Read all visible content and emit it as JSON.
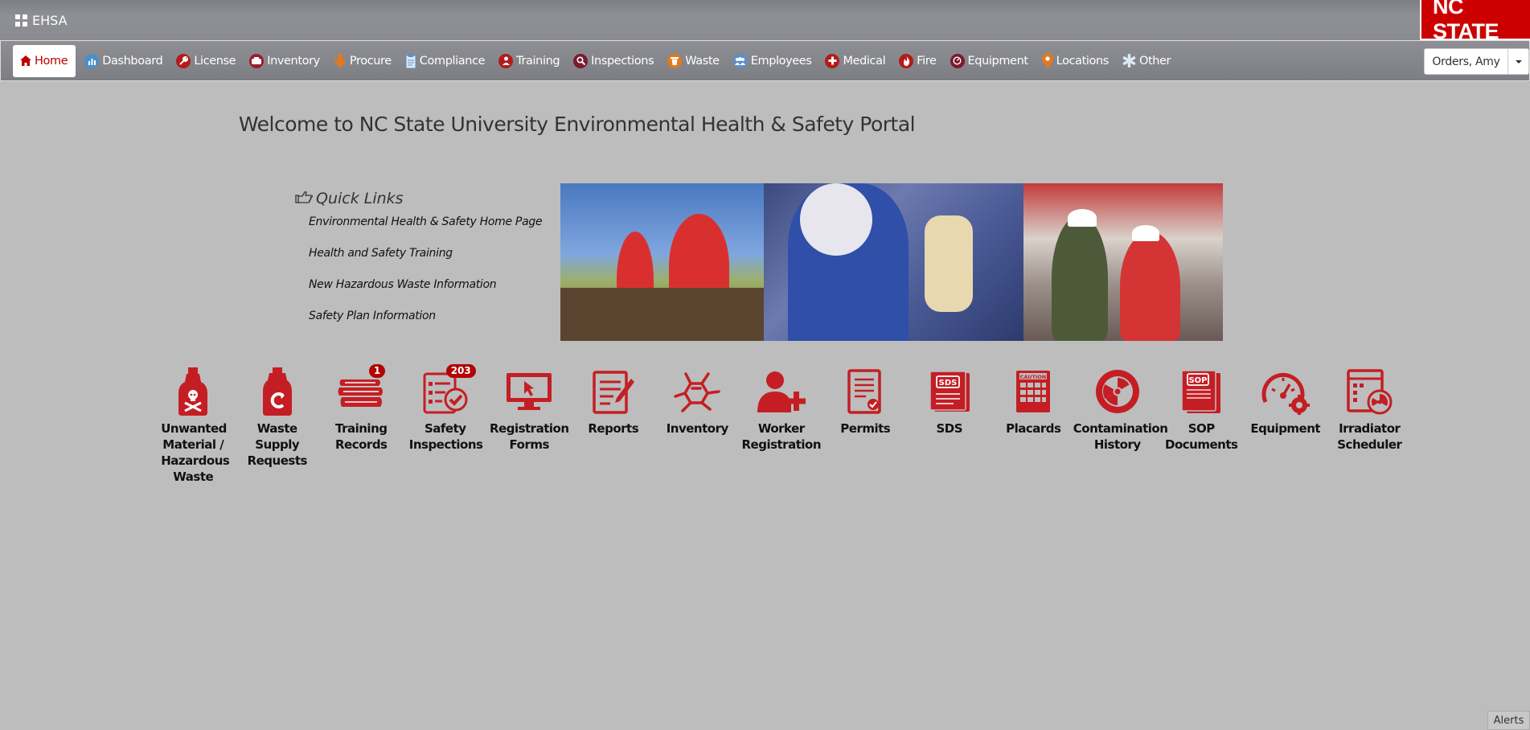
{
  "app": {
    "title": "EHSA",
    "logo_text": "NC STATE"
  },
  "nav": {
    "items": [
      {
        "label": "Home",
        "icon": "home-icon",
        "active": true
      },
      {
        "label": "Dashboard",
        "icon": "dashboard-icon",
        "color": "#4a90c8"
      },
      {
        "label": "License",
        "icon": "wrench-icon",
        "color": "#b31b1b"
      },
      {
        "label": "Inventory",
        "icon": "inventory-icon",
        "color": "#9b1c2e"
      },
      {
        "label": "Procure",
        "icon": "procure-arrow-icon",
        "color": "#e07a1f"
      },
      {
        "label": "Compliance",
        "icon": "clipboard-icon",
        "color": "#5b8fc8"
      },
      {
        "label": "Training",
        "icon": "training-icon",
        "color": "#b31b1b"
      },
      {
        "label": "Inspections",
        "icon": "magnifier-icon",
        "color": "#7a1b2e"
      },
      {
        "label": "Waste",
        "icon": "trash-icon",
        "color": "#e07a1f"
      },
      {
        "label": "Employees",
        "icon": "employees-icon",
        "color": "#5b8fc8"
      },
      {
        "label": "Medical",
        "icon": "medical-cross-icon",
        "color": "#b31b1b"
      },
      {
        "label": "Fire",
        "icon": "fire-icon",
        "color": "#b31b1b"
      },
      {
        "label": "Equipment",
        "icon": "equipment-icon",
        "color": "#7a1b2e"
      },
      {
        "label": "Locations",
        "icon": "location-pin-icon",
        "color": "#e07a1f"
      },
      {
        "label": "Other",
        "icon": "asterisk-icon",
        "color": "#5b8fc8"
      }
    ]
  },
  "user": {
    "name": "Orders, Amy"
  },
  "welcome": "Welcome to NC State University Environmental Health & Safety Portal",
  "quick_links": {
    "title": "Quick Links",
    "links": [
      "Environmental Health & Safety Home Page",
      "Health and Safety Training",
      "New Hazardous Waste Information",
      "Safety Plan Information"
    ]
  },
  "tiles": [
    {
      "label": "Unwanted Material / Hazardous Waste",
      "icon": "hazardous-bottle-icon"
    },
    {
      "label": "Waste Supply Requests",
      "icon": "waste-supply-jug-icon"
    },
    {
      "label": "Training Records",
      "icon": "training-records-icon",
      "badge": "1"
    },
    {
      "label": "Safety Inspections",
      "icon": "safety-inspections-icon",
      "badge": "203"
    },
    {
      "label": "Registration Forms",
      "icon": "registration-monitor-icon"
    },
    {
      "label": "Reports",
      "icon": "reports-icon"
    },
    {
      "label": "Inventory",
      "icon": "molecule-icon"
    },
    {
      "label": "Worker Registration",
      "icon": "add-worker-icon"
    },
    {
      "label": "Permits",
      "icon": "permits-icon"
    },
    {
      "label": "SDS",
      "icon": "sds-icon"
    },
    {
      "label": "Placards",
      "icon": "placards-icon"
    },
    {
      "label": "Contamination History",
      "icon": "radiation-icon"
    },
    {
      "label": "SOP Documents",
      "icon": "sop-icon"
    },
    {
      "label": "Equipment",
      "icon": "gauge-icon"
    },
    {
      "label": "Irradiator Scheduler",
      "icon": "irradiator-icon"
    }
  ],
  "alerts_label": "Alerts",
  "colors": {
    "accent": "#c41e24",
    "background": "#bdbdbd"
  }
}
